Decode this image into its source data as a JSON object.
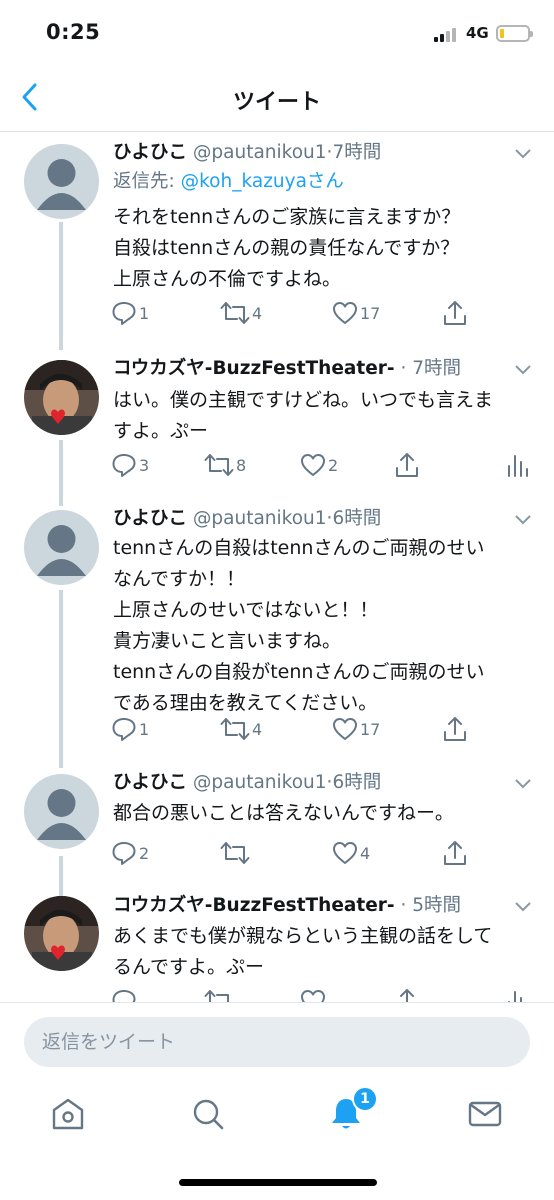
{
  "status": {
    "time": "0:25",
    "network": "4G",
    "battery_level": 0.12,
    "signal_bars": 2
  },
  "nav": {
    "title": "ツイート",
    "back_icon": "chevron-left-icon"
  },
  "tweets": [
    {
      "name": "ひよひこ",
      "handle": "@pautanikou1",
      "time": "7時間",
      "reply_to_label": "返信先: ",
      "reply_to_user": "@koh_kazuyaさん",
      "avatar": "default-avatar",
      "lines": [
        "それをtennさんのご家族に言えますか？",
        "自殺はtennさんの親の責任なんですか？",
        "上原さんの不倫ですよね。"
      ],
      "replies": "1",
      "retweets": "4",
      "likes": "17"
    },
    {
      "name": "コウカズヤ-BuzzFestTheater-",
      "handle": "",
      "time": "7時間",
      "avatar": "photo-avatar",
      "lines": [
        "はい。僕の主観ですけどね。いつでも言えま",
        "すよ。ぷー"
      ],
      "replies": "3",
      "retweets": "8",
      "likes": "2"
    },
    {
      "name": "ひよひこ",
      "handle": "@pautanikou1",
      "time": "6時間",
      "avatar": "default-avatar",
      "lines": [
        "tennさんの自殺はtennさんのご両親のせい",
        "なんですか！！",
        "上原さんのせいではないと！！",
        "貴方凄いこと言いますね。",
        "tennさんの自殺がtennさんのご両親のせい",
        "である理由を教えてください。"
      ],
      "replies": "1",
      "retweets": "4",
      "likes": "17"
    },
    {
      "name": "ひよひこ",
      "handle": "@pautanikou1",
      "time": "6時間",
      "avatar": "default-avatar",
      "lines": [
        "都合の悪いことは答えないんですねー。"
      ],
      "replies": "2",
      "retweets": "",
      "likes": "4"
    },
    {
      "name": "コウカズヤ-BuzzFestTheater-",
      "handle": "",
      "time": "5時間",
      "avatar": "photo-avatar",
      "lines": [
        "あくまでも僕が親ならという主観の話をして",
        "るんですよ。ぷー"
      ],
      "replies": "",
      "retweets": "",
      "likes": ""
    }
  ],
  "reply_bar": {
    "placeholder": "返信をツイート"
  },
  "tabs": [
    {
      "name": "home-tab",
      "icon": "home-icon"
    },
    {
      "name": "search-tab",
      "icon": "search-icon"
    },
    {
      "name": "notifications-tab",
      "icon": "bell-icon",
      "badge": "1"
    },
    {
      "name": "messages-tab",
      "icon": "mail-icon"
    }
  ],
  "colors": {
    "accent": "#1da1f2",
    "text": "#14171a",
    "secondary": "#657786",
    "thread": "#ccd6dd"
  }
}
